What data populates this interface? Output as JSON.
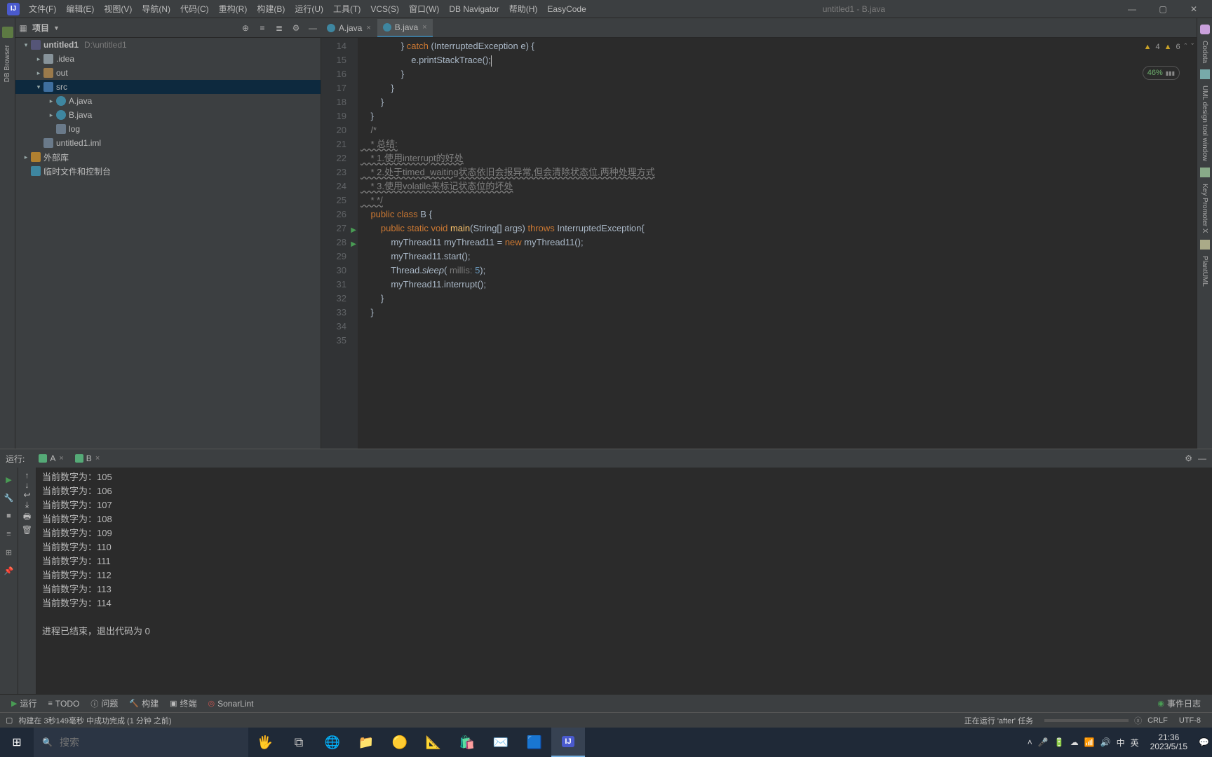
{
  "title": "untitled1 - B.java",
  "menus": [
    "文件(F)",
    "编辑(E)",
    "视图(V)",
    "导航(N)",
    "代码(C)",
    "重构(R)",
    "构建(B)",
    "运行(U)",
    "工具(T)",
    "VCS(S)",
    "窗口(W)",
    "DB Navigator",
    "帮助(H)",
    "EasyCode"
  ],
  "project_panel_title": "项目",
  "tree": {
    "root": {
      "name": "untitled1",
      "path": "D:\\untitled1"
    },
    "idea": ".idea",
    "out": "out",
    "src": "src",
    "a": "A.java",
    "b": "B.java",
    "log": "log",
    "iml": "untitled1.iml",
    "extlib": "外部库",
    "temp": "临时文件和控制台"
  },
  "tabs": [
    {
      "name": "A.java",
      "sel": false
    },
    {
      "name": "B.java",
      "sel": true
    }
  ],
  "editor": {
    "inspections": {
      "warn1": "4",
      "warn2": "6"
    },
    "badge_pct": "46%",
    "lines": [
      {
        "n": 14,
        "t": "                } catch (InterruptedException e) {",
        "seg": [
          [
            "",
            "                } "
          ],
          [
            "kw",
            "catch"
          ],
          [
            "",
            " ("
          ],
          [
            "",
            "InterruptedException e"
          ],
          [
            "",
            ") {"
          ]
        ]
      },
      {
        "n": 15,
        "t": "                    e.printStackTrace();",
        "seg": [
          [
            "",
            "                    e.printStackTrace();"
          ]
        ],
        "caret": true
      },
      {
        "n": 16,
        "t": "                }",
        "seg": [
          [
            "",
            "                }"
          ]
        ]
      },
      {
        "n": 17,
        "t": "",
        "seg": [
          [
            "",
            ""
          ]
        ]
      },
      {
        "n": 18,
        "t": "            }",
        "seg": [
          [
            "",
            "            }"
          ]
        ]
      },
      {
        "n": 19,
        "t": "        }",
        "seg": [
          [
            "",
            "        }"
          ]
        ]
      },
      {
        "n": 20,
        "t": "    }",
        "seg": [
          [
            "",
            "    }"
          ]
        ]
      },
      {
        "n": 21,
        "t": "    /*",
        "seg": [
          [
            "com",
            "    /*"
          ]
        ]
      },
      {
        "n": 22,
        "t": "    * 总结:",
        "seg": [
          [
            "comd",
            "    * 总结:"
          ]
        ]
      },
      {
        "n": 23,
        "t": "    * 1.使用interrupt的好处",
        "seg": [
          [
            "comd",
            "    * 1.使用interrupt的好处"
          ]
        ]
      },
      {
        "n": 24,
        "t": "    * 2.处于timed_waiting状态依旧会报异常,但会清除状态位.两种处理方式",
        "seg": [
          [
            "comd",
            "    * 2.处于timed_waiting状态依旧会报异常,但会清除状态位.两种处理方式"
          ]
        ]
      },
      {
        "n": 25,
        "t": "    * 3.使用volatile来标记状态位的坏处",
        "seg": [
          [
            "comd",
            "    * 3.使用volatile来标记状态位的坏处"
          ]
        ]
      },
      {
        "n": 26,
        "t": "    * */",
        "seg": [
          [
            "comd",
            "    * */"
          ]
        ]
      },
      {
        "n": 27,
        "t": "    public class B {",
        "seg": [
          [
            "",
            "    "
          ],
          [
            "kw",
            "public"
          ],
          [
            "",
            " "
          ],
          [
            "kw",
            "class"
          ],
          [
            "",
            " B {"
          ]
        ],
        "run": true
      },
      {
        "n": 28,
        "t": "        public static void main(String[] args) throws InterruptedException{",
        "seg": [
          [
            "",
            "        "
          ],
          [
            "kw",
            "public"
          ],
          [
            "",
            " "
          ],
          [
            "kw",
            "static"
          ],
          [
            "",
            " "
          ],
          [
            "kw",
            "void"
          ],
          [
            "",
            " "
          ],
          [
            "fn",
            "main"
          ],
          [
            "",
            "(String[] args) "
          ],
          [
            "kw",
            "throws"
          ],
          [
            "",
            " InterruptedException{"
          ]
        ],
        "run": true
      },
      {
        "n": 29,
        "t": "            myThread11 myThread11 = new myThread11();",
        "seg": [
          [
            "",
            "            myThread11 myThread11 = "
          ],
          [
            "kw",
            "new"
          ],
          [
            "",
            " myThread11();"
          ]
        ]
      },
      {
        "n": 30,
        "t": "            myThread11.start();",
        "seg": [
          [
            "",
            "            myThread11.start();"
          ]
        ]
      },
      {
        "n": 31,
        "t": "",
        "seg": [
          [
            "",
            ""
          ]
        ]
      },
      {
        "n": 32,
        "t": "            Thread.sleep( millis: 5);",
        "seg": [
          [
            "",
            "            Thread."
          ],
          [
            "it",
            "sleep"
          ],
          [
            "",
            "( "
          ],
          [
            "hint",
            "millis: "
          ],
          [
            "num",
            "5"
          ],
          [
            "",
            ");"
          ]
        ]
      },
      {
        "n": 33,
        "t": "            myThread11.interrupt();",
        "seg": [
          [
            "",
            "            myThread11.interrupt();"
          ]
        ]
      },
      {
        "n": 34,
        "t": "        }",
        "seg": [
          [
            "",
            "        }"
          ]
        ]
      },
      {
        "n": 35,
        "t": "    }",
        "seg": [
          [
            "",
            "    }"
          ]
        ]
      }
    ]
  },
  "run": {
    "label": "运行:",
    "tabs": [
      "A",
      "B"
    ],
    "output": [
      "当前数字为：105",
      "当前数字为：106",
      "当前数字为：107",
      "当前数字为：108",
      "当前数字为：109",
      "当前数字为：110",
      "当前数字为：111",
      "当前数字为：112",
      "当前数字为：113",
      "当前数字为：114",
      "",
      "进程已结束，退出代码为 0"
    ]
  },
  "bottombar": {
    "run": "运行",
    "todo": "TODO",
    "problems": "问题",
    "build": "构建",
    "terminal": "终端",
    "sonar": "SonarLint",
    "eventlog": "事件日志"
  },
  "statusbar": {
    "msg": "构建在 3秒149毫秒 中成功完成 (1 分钟 之前)",
    "running": "正在运行 'after' 任务",
    "crlf": "CRLF",
    "enc": "UTF-8"
  },
  "leftstrip": {
    "dbbrowser": "DB Browser"
  },
  "rightstrip": {
    "codota": "Codota",
    "uml": "UML design tool window",
    "keypx": "Key Promoter X",
    "plantuml": "PlantUML"
  },
  "taskbar": {
    "search_placeholder": "搜索",
    "time": "21:36",
    "date": "2023/5/15"
  }
}
